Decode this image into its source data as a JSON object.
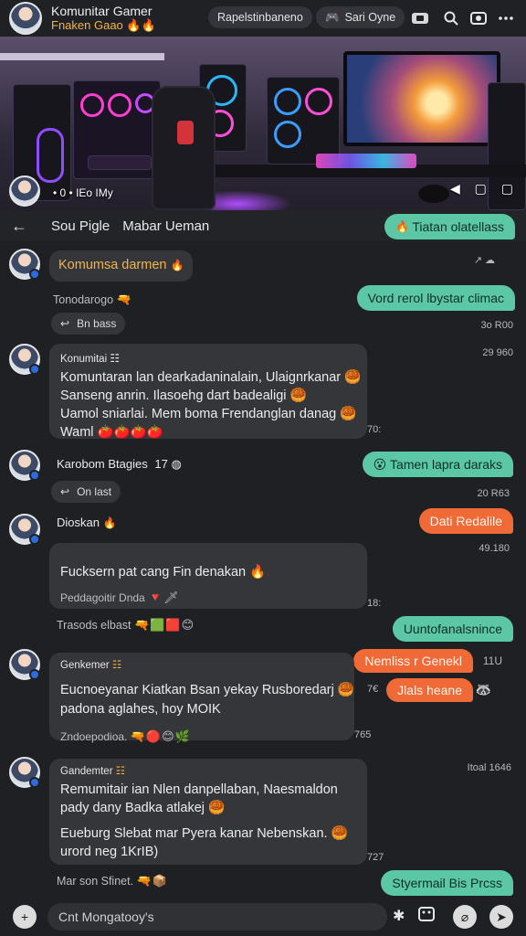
{
  "header": {
    "title": "Komunitar Gamer",
    "subtitle": "Fnaken Gaao",
    "subtitle_emojis": "🔥🔥",
    "pill_1": "Rapelstinbaneno",
    "pill_2": "Sari Oyne",
    "pill_2_icon": "🎮"
  },
  "banner": {
    "member_count": "• 0 • IEo IMy",
    "icons": "◀ ▢ ▢"
  },
  "subheader": {
    "back_icon": "←",
    "title": "Sou Pigle",
    "subtitle": "Mabar Ueman"
  },
  "messages": {
    "out1": "Tiatan olatellass",
    "in1_text": "Komumsa darmen",
    "in1_emoji": "🔥",
    "meta1": "↗ ☁",
    "caption1": "Tonodarogo",
    "out2": "Vord rerol lbystar climac",
    "reaction1": "Bn bass",
    "meta2": "3o R00",
    "in2_name": "Konumitai",
    "in2_line1": "Komuntaran lan dearkadaninalain, Ulaignrkanar",
    "in2_line2": "Sanseng anrin. Ilasoehg dart badealigi",
    "in2_line3": "Uamol sniarlai. Mem boma  Frendanglan danag",
    "in2_line4": "Waml",
    "in2_stickers": "🍅🍅🍅🍅",
    "meta3": "29 960",
    "meta4": "70:",
    "in3_name": "Karobom Btagies",
    "in3_count": "17",
    "out3": "Tamen lapra daraks",
    "reaction2": "On last",
    "meta5": "20 R63",
    "in4_name": "Dioskan",
    "out4": "Dati Redalile",
    "meta6": "49.180",
    "in4_line1": "Fucksern pat cang Fin denakan",
    "in4_caption": "Peddagoitir Dnda",
    "meta7": "18:",
    "caption2": "Trasods elbast",
    "out5": "Uuntofanalsnince",
    "in5_name": "Genkemer",
    "out6": "Nemliss r Genekl",
    "meta8": "11U",
    "out7": "Jlals heane",
    "in5_line1": "Eucnoeyanar Kiatkan Bsan yekay Rusboredarj",
    "in5_line2": "padona aglahes, hoy MOIK",
    "in5_caption": "Zndoepodioa.",
    "meta9": "7€",
    "meta10": "765",
    "in6_name": "Gandemter",
    "meta11": "Itoal 1646",
    "in6_line1": "Remumitair ian Nlen danpellaban, Naesmaldon",
    "in6_line2": "pady dany Badka atlakej",
    "in6_line3": "Eueburg Slebat mar Pyera kanar Nebenskan.",
    "in6_line4": "urord neg 1KrIB)",
    "meta12": "727",
    "caption3": "Mar son Sfinet.",
    "out8": "Styermail Bis Prcss"
  },
  "composer": {
    "placeholder": "Cnt Mongatooy's",
    "plus_icon": "+",
    "send_icon": "➤"
  },
  "colors": {
    "bg": "#1f2023",
    "bubble": "#35363a",
    "out_green": "#5bc7a5",
    "out_orange": "#ef6a36",
    "accent_gold": "#f2b44a"
  }
}
